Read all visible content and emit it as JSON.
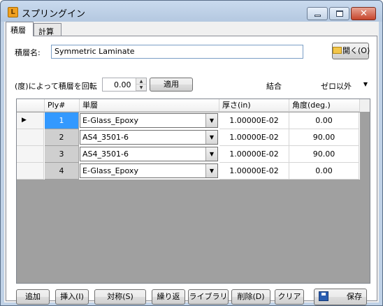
{
  "window": {
    "title": "スプリングイン"
  },
  "tabs": [
    {
      "label": "積層"
    },
    {
      "label": "計算"
    }
  ],
  "laminate": {
    "name_label": "積層名:",
    "name_value": "Symmetric Laminate",
    "open_button": "開く(O)"
  },
  "rotate": {
    "label": "(度)によって積層を回転",
    "value": "0.00",
    "apply_button": "適用"
  },
  "bond": {
    "label": "結合",
    "selected": "ゼロ以外"
  },
  "table": {
    "columns": [
      "Ply#",
      "単層",
      "厚さ(in)",
      "角度(deg.)"
    ],
    "rows": [
      {
        "ply": "1",
        "material": "E-Glass_Epoxy",
        "thickness": "1.00000E-02",
        "angle": "0.00"
      },
      {
        "ply": "2",
        "material": "AS4_3501-6",
        "thickness": "1.00000E-02",
        "angle": "90.00"
      },
      {
        "ply": "3",
        "material": "AS4_3501-6",
        "thickness": "1.00000E-02",
        "angle": "90.00"
      },
      {
        "ply": "4",
        "material": "E-Glass_Epoxy",
        "thickness": "1.00000E-02",
        "angle": "0.00"
      }
    ]
  },
  "buttons": {
    "add": "追加",
    "insert": "挿入(I)",
    "symmetric": "対称(S)",
    "repeat": "繰り返",
    "library": "ライブラリ",
    "delete": "削除(D)",
    "clear": "クリア",
    "save": "保存"
  },
  "colors": {
    "selected_cell": "#3399ff",
    "grid_bg": "#a0a0a0",
    "titlebar": "#c9daee"
  }
}
